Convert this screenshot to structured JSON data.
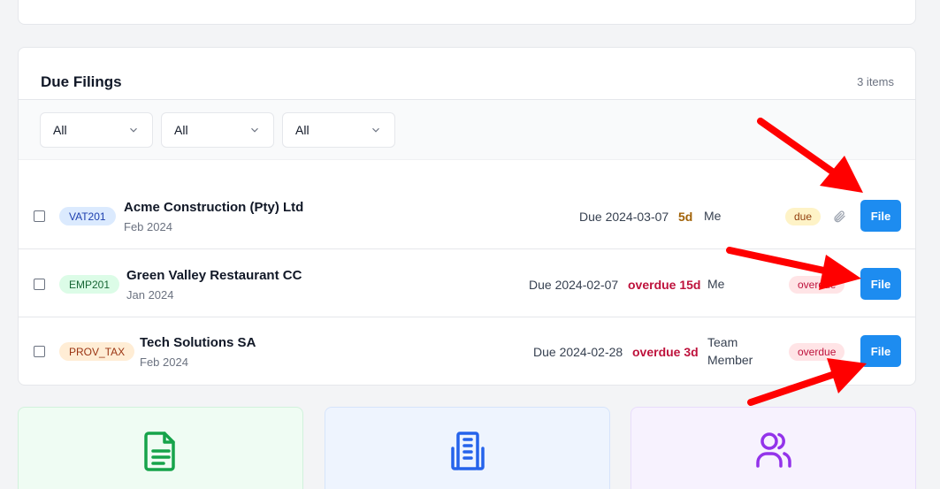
{
  "panel": {
    "title": "Due Filings",
    "count": "3 items"
  },
  "filters": [
    {
      "value": "All"
    },
    {
      "value": "All"
    },
    {
      "value": "All"
    }
  ],
  "rows": [
    {
      "tag": "VAT201",
      "company": "Acme Construction (Pty) Ltd",
      "period": "Feb 2024",
      "due": "Due 2024-03-07",
      "days": "5d",
      "owner": "Me",
      "status": "due",
      "action": "File"
    },
    {
      "tag": "EMP201",
      "company": "Green Valley Restaurant CC",
      "period": "Jan 2024",
      "due": "Due 2024-02-07",
      "days": "overdue 15d",
      "owner": "Me",
      "status": "overdue",
      "action": "File"
    },
    {
      "tag": "PROV_TAX",
      "company": "Tech Solutions SA",
      "period": "Feb 2024",
      "due": "Due 2024-02-28",
      "days": "overdue 3d",
      "owner_line1": "Team",
      "owner_line2": "Member",
      "status": "overdue",
      "action": "File"
    }
  ],
  "cards": [
    {
      "icon": "document-icon",
      "color": "#16a34a"
    },
    {
      "icon": "building-icon",
      "color": "#2563eb"
    },
    {
      "icon": "users-icon",
      "color": "#9333ea"
    }
  ],
  "colors": {
    "accent": "#1d8cf0",
    "annotation": "#ff0000"
  }
}
